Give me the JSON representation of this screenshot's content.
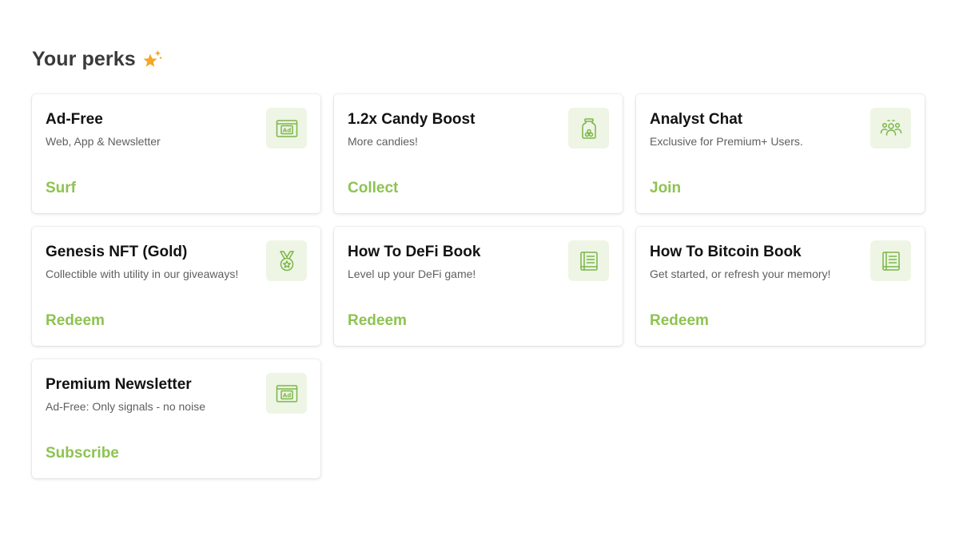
{
  "header": {
    "title": "Your perks",
    "title_icon": "sparkle-star-icon"
  },
  "colors": {
    "accent": "#8dc351",
    "icon_bg": "#eef5e4",
    "star": "#f5a623"
  },
  "perks": [
    {
      "title": "Ad-Free",
      "description": "Web, App & Newsletter",
      "action": "Surf",
      "icon": "ad-screen-icon"
    },
    {
      "title": "1.2x Candy Boost",
      "description": "More candies!",
      "action": "Collect",
      "icon": "candy-jar-icon"
    },
    {
      "title": "Analyst Chat",
      "description": "Exclusive for Premium+ Users.",
      "action": "Join",
      "icon": "group-chat-icon"
    },
    {
      "title": "Genesis NFT (Gold)",
      "description": "Collectible with utility in our giveaways!",
      "action": "Redeem",
      "icon": "medal-icon"
    },
    {
      "title": "How To DeFi Book",
      "description": "Level up your DeFi game!",
      "action": "Redeem",
      "icon": "book-icon"
    },
    {
      "title": "How To Bitcoin Book",
      "description": "Get started, or refresh your memory!",
      "action": "Redeem",
      "icon": "book-icon"
    },
    {
      "title": "Premium Newsletter",
      "description": "Ad-Free: Only signals - no noise",
      "action": "Subscribe",
      "icon": "ad-screen-icon"
    }
  ]
}
